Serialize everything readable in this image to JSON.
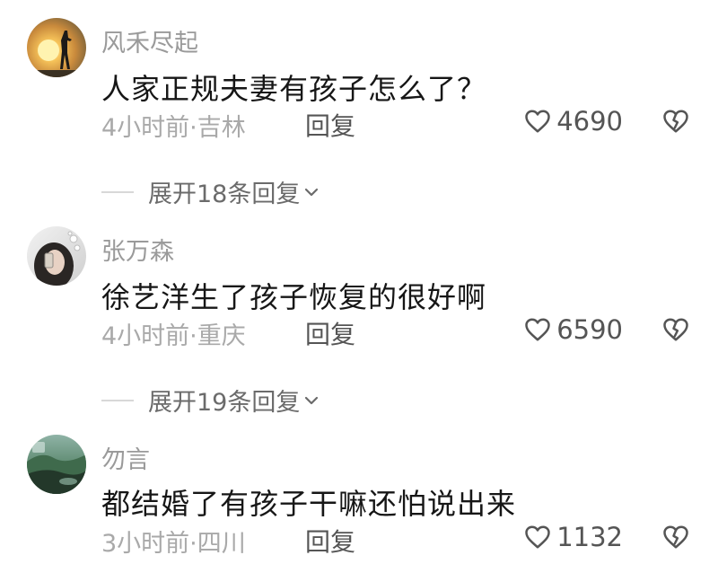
{
  "comments": [
    {
      "username": "风禾尽起",
      "text": "人家正规夫妻有孩子怎么了？",
      "meta": "4小时前·吉林",
      "reply_label": "回复",
      "likes": "4690",
      "expand_label": "展开18条回复",
      "avatar": "sunset-silhouette-avatar"
    },
    {
      "username": "张万森",
      "text": "徐艺洋生了孩子恢复的很好啊",
      "meta": "4小时前·重庆",
      "reply_label": "回复",
      "likes": "6590",
      "expand_label": "展开19条回复",
      "avatar": "selfie-avatar"
    },
    {
      "username": "勿言",
      "text": "都结婚了有孩子干嘛还怕说出来",
      "meta": "3小时前·四川",
      "reply_label": "回复",
      "likes": "1132",
      "avatar": "landscape-avatar"
    }
  ],
  "icons": {
    "like": "heart-outline-icon",
    "dislike": "broken-heart-icon",
    "expand": "chevron-down-icon"
  },
  "colors": {
    "username": "#9a9a9a",
    "text": "#161616",
    "meta": "#a9a9a9",
    "action": "#555555"
  }
}
